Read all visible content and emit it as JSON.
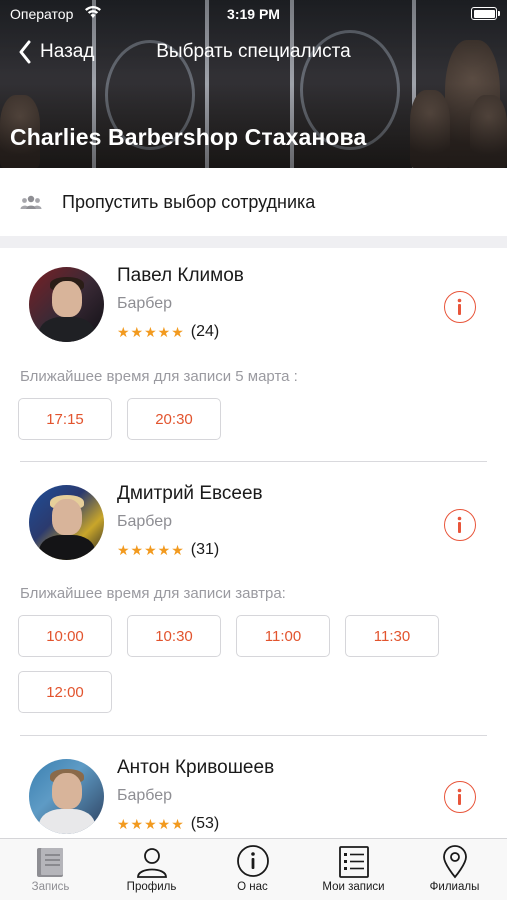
{
  "status_bar": {
    "carrier": "Оператор",
    "time": "3:19 PM",
    "battery_level": 1.0
  },
  "nav": {
    "back_label": "Назад",
    "title": "Выбрать специалиста"
  },
  "shop": {
    "name": "Charlies Barbershop Стаханова"
  },
  "skip": {
    "label": "Пропустить выбор сотрудника",
    "icon": "group-icon"
  },
  "colors": {
    "accent": "#e2542e",
    "star": "#f29a1f",
    "secondary_text": "#8e8e93"
  },
  "specialists": [
    {
      "name": "Павел Климов",
      "role": "Барбер",
      "stars": "★★★★★",
      "rating_value": 5,
      "reviews": "(24)",
      "next_label": "Ближайшее время для записи 5 марта :",
      "slots": [
        "17:15",
        "20:30"
      ]
    },
    {
      "name": "Дмитрий Евсеев",
      "role": "Барбер",
      "stars": "★★★★★",
      "rating_value": 5,
      "reviews": "(31)",
      "next_label": "Ближайшее время для записи завтра:",
      "slots": [
        "10:00",
        "10:30",
        "11:00",
        "11:30",
        "12:00"
      ]
    },
    {
      "name": "Антон Кривошеев",
      "role": "Барбер",
      "stars": "★★★★★",
      "rating_value": 5,
      "reviews": "(53)"
    }
  ],
  "tabs": [
    {
      "label": "Запись",
      "icon": "book-icon",
      "active": true
    },
    {
      "label": "Профиль",
      "icon": "profile-icon",
      "active": false
    },
    {
      "label": "О нас",
      "icon": "info-icon",
      "active": false
    },
    {
      "label": "Мои записи",
      "icon": "list-icon",
      "active": false
    },
    {
      "label": "Филиалы",
      "icon": "location-pin-icon",
      "active": false
    }
  ]
}
